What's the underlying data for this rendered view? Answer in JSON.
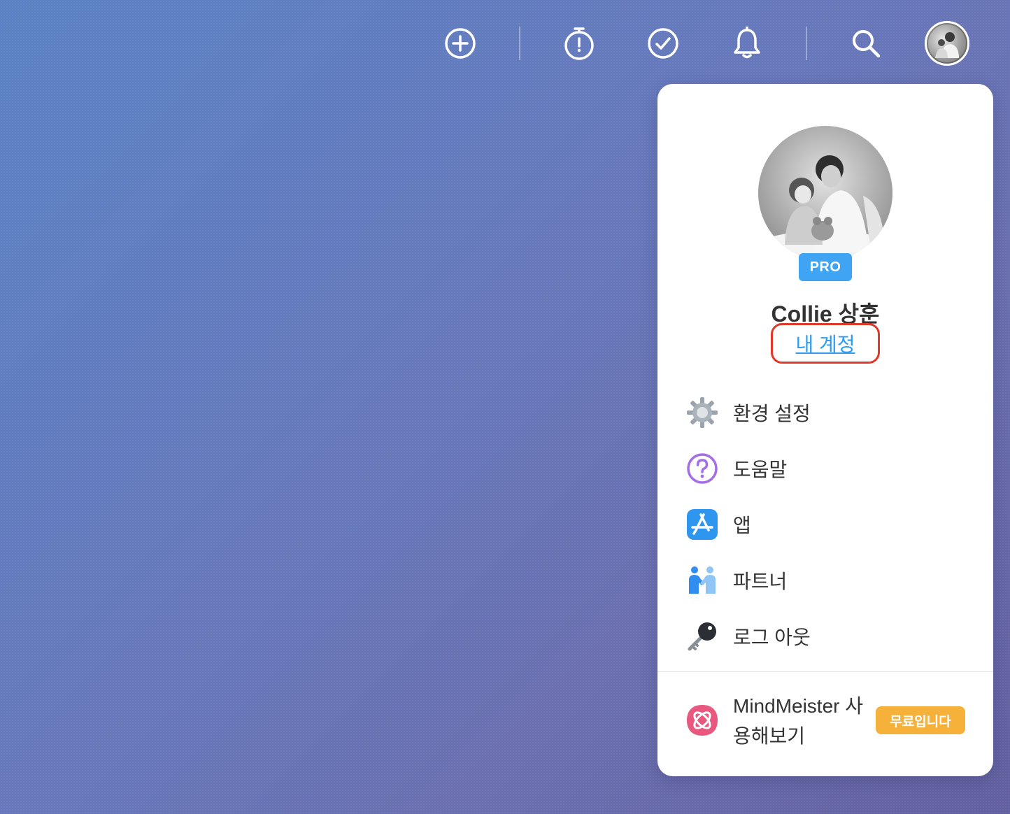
{
  "topbar": {
    "icons": [
      "add-icon",
      "timer-icon",
      "check-icon",
      "bell-icon",
      "search-icon",
      "avatar"
    ],
    "icon_color": "#ffffff"
  },
  "profile": {
    "badge": "PRO",
    "name": "Collie 상훈",
    "account_link": "내 계정",
    "link_color": "#2f9cf0",
    "highlight_color": "#e0392a"
  },
  "menu": {
    "items": [
      {
        "icon": "gear-icon",
        "label": "환경 설정"
      },
      {
        "icon": "help-icon",
        "label": "도움말"
      },
      {
        "icon": "app-store-icon",
        "label": "앱"
      },
      {
        "icon": "partners-icon",
        "label": "파트너"
      },
      {
        "icon": "key-icon",
        "label": "로그 아웃"
      }
    ]
  },
  "promo": {
    "icon": "mindmeister-icon",
    "text": "MindMeister 사용해보기",
    "badge": "무료입니다",
    "badge_color": "#f5b13a"
  }
}
